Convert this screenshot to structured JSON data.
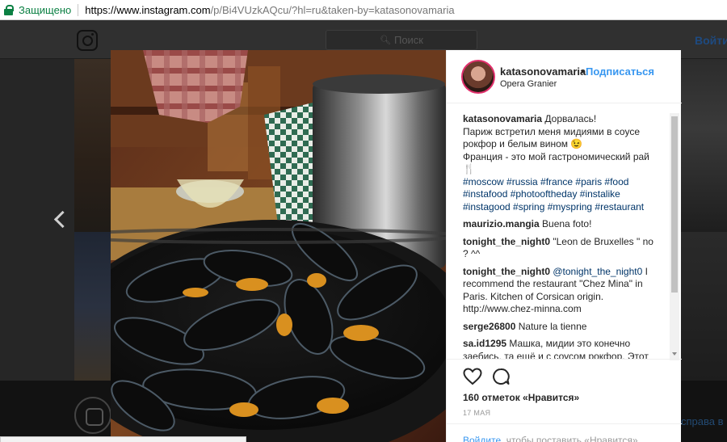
{
  "browser": {
    "secure_label": "Защищено",
    "url_host": "https://www.instagram.com",
    "url_rest": "/p/Bi4VUzkAQcu/?hl=ru&taken-by=katasonovamaria"
  },
  "instagram_bg": {
    "search_placeholder": "Поиск",
    "login_label": "Войти",
    "footer_right_text": "справа в"
  },
  "post": {
    "username": "katasonovamaria",
    "dot": "•",
    "follow_label": "Подписаться",
    "location": "Opera Granier",
    "caption_user": "katasonovamaria",
    "caption_lines": [
      "Дорвалась!",
      "Париж встретил меня мидиями в соусе рокфор и белым вином 😉",
      "Франция - это мой гастрономический рай 🍴"
    ],
    "hashtags": "#moscow #russia #france #paris #food #instafood #photooftheday #instalike #instagood #spring #myspring #restaurant",
    "comments": [
      {
        "user": "maurizio.mangia",
        "text": "Buena foto!"
      },
      {
        "user": "tonight_the_night0",
        "text": "\"Leon de Bruxelles \" no ? ^^"
      },
      {
        "user": "tonight_the_night0",
        "mention": "@tonight_the_night0",
        "text": " I recommend the restaurant \"Chez Mina\" in Paris. Kitchen of Corsican origin. http://www.chez-minna.com"
      },
      {
        "user": "serge26800",
        "text": "Nature la tienne"
      },
      {
        "user": "sa.id1295",
        "text": "Машка, мидии это конечно заебись, та ещё и с соусом рокфор. Этот"
      }
    ],
    "likes": "160 отметок «Нравится»",
    "date": "17 МАЯ",
    "login_link": "Войдите",
    "login_rest": ", чтобы поставить «Нравится»"
  },
  "icons": {
    "heart": "heart-icon",
    "comment": "comment-icon",
    "prev": "chevron-left-icon",
    "instagram_logo": "instagram-logo-icon"
  },
  "colors": {
    "link_blue": "#3897f0",
    "hashtag_blue": "#003569",
    "secure_green": "#0b8043"
  }
}
